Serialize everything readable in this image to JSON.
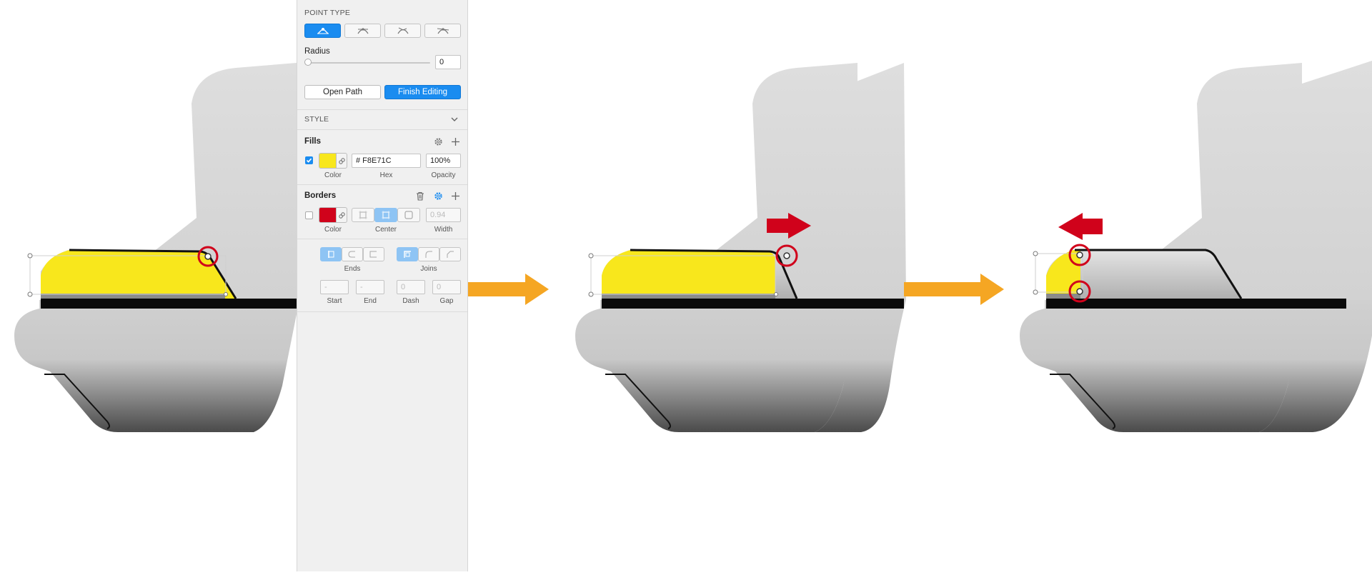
{
  "panel": {
    "point_type": {
      "header": "POINT TYPE",
      "options": [
        "straight",
        "mirrored",
        "disconnected",
        "asymmetric"
      ],
      "selected": "straight"
    },
    "radius": {
      "label": "Radius",
      "value": "0",
      "slider": 0
    },
    "path_buttons": {
      "open_path": "Open Path",
      "finish_editing": "Finish Editing"
    },
    "style": {
      "header": "STYLE"
    },
    "fills": {
      "title": "Fills",
      "enabled": true,
      "color": "#F8E71C",
      "hex": "# F8E71C",
      "opacity": "100%",
      "labels": {
        "color": "Color",
        "hex": "Hex",
        "opacity": "Opacity"
      }
    },
    "borders": {
      "title": "Borders",
      "enabled": false,
      "color": "#D0021B",
      "position": "center",
      "width": "0.94",
      "labels": {
        "color": "Color",
        "center": "Center",
        "width": "Width"
      }
    },
    "line_options": {
      "ends_label": "Ends",
      "joins_label": "Joins",
      "start": "-",
      "end": "-",
      "dash": "0",
      "gap": "0",
      "labels": {
        "start": "Start",
        "end": "End",
        "dash": "Dash",
        "gap": "Gap"
      }
    }
  },
  "colors": {
    "accent": "#1A8CF0",
    "highlight_fill": "#F8E71C",
    "marker_red": "#D0021B",
    "flow_arrow": "#F5A623"
  }
}
